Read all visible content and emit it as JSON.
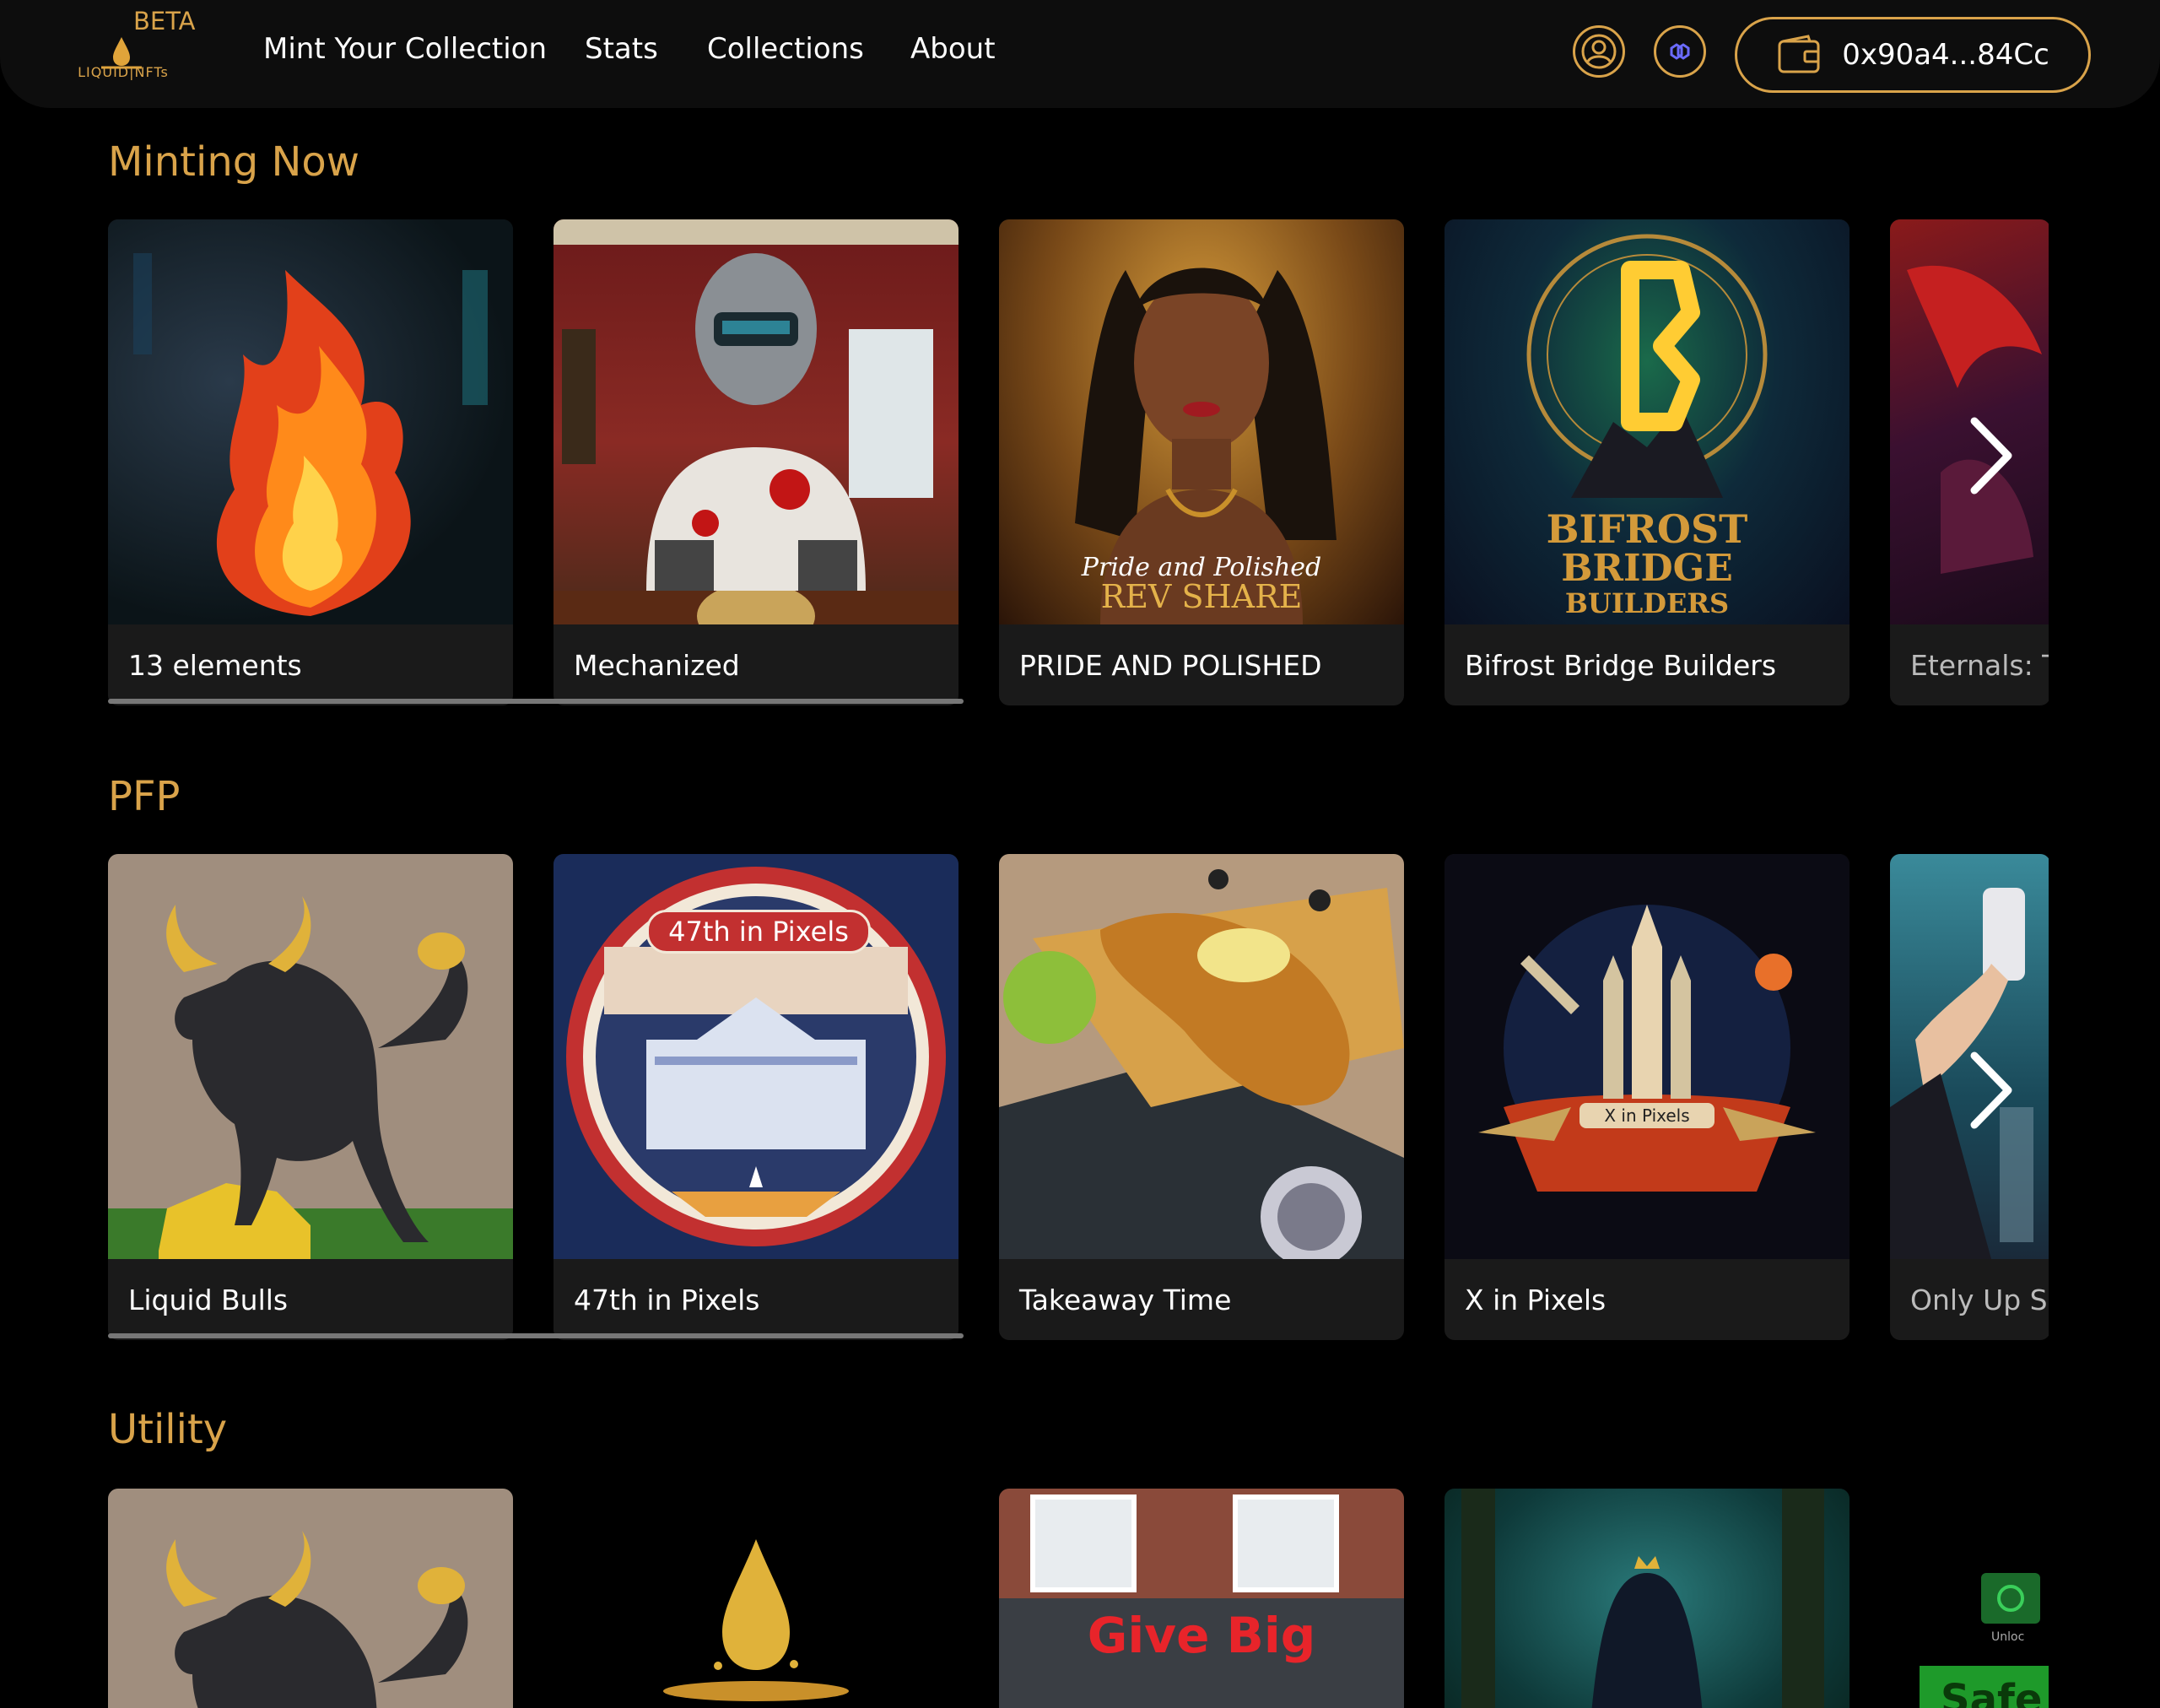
{
  "header": {
    "beta_label": "BETA",
    "logo_text": "LIQUID|NFTs",
    "nav": [
      "Mint Your Collection",
      "Stats",
      "Collections",
      "About"
    ],
    "wallet_address": "0x90a4...84Cc",
    "icons": {
      "profile": "user-circle-icon",
      "network": "chain-link-icon",
      "wallet": "wallet-icon"
    }
  },
  "colors": {
    "accent": "#d9a34a",
    "background": "#000000",
    "card": "#1a1a1a"
  },
  "sections": [
    {
      "title": "Minting Now",
      "cards": [
        {
          "label": "13 elements",
          "art": "fire"
        },
        {
          "label": "Mechanized",
          "art": "robot-office"
        },
        {
          "label": "PRIDE AND POLISHED",
          "art": "portrait",
          "art_text": [
            "Pride and Polished",
            "REV SHARE"
          ]
        },
        {
          "label": "Bifrost Bridge Builders",
          "art": "rune",
          "art_text": [
            "BIFROST",
            "BRIDGE",
            "BUILDERS"
          ]
        },
        {
          "label": "Eternals: Tl",
          "art": "dragon"
        }
      ],
      "scroll_progress": 0.3
    },
    {
      "title": "PFP",
      "cards": [
        {
          "label": "Liquid Bulls",
          "art": "bull"
        },
        {
          "label": "47th in Pixels",
          "art": "white-house",
          "art_text": [
            "47th in Pixels"
          ]
        },
        {
          "label": "Takeaway Time",
          "art": "fish-chips"
        },
        {
          "label": "X in Pixels",
          "art": "rockets",
          "art_text": [
            "X in Pixels"
          ]
        },
        {
          "label": "Only Up Se",
          "art": "selfie"
        }
      ],
      "scroll_progress": 0.3
    },
    {
      "title": "Utility",
      "cards": [
        {
          "label": "",
          "art": "bull"
        },
        {
          "label": "",
          "art": "drop"
        },
        {
          "label": "",
          "art": "shopfront",
          "art_text": [
            "Give Big"
          ]
        },
        {
          "label": "",
          "art": "forest"
        },
        {
          "label": "",
          "art": "safe",
          "art_text": [
            "Unloc",
            "Safe"
          ]
        }
      ]
    }
  ]
}
